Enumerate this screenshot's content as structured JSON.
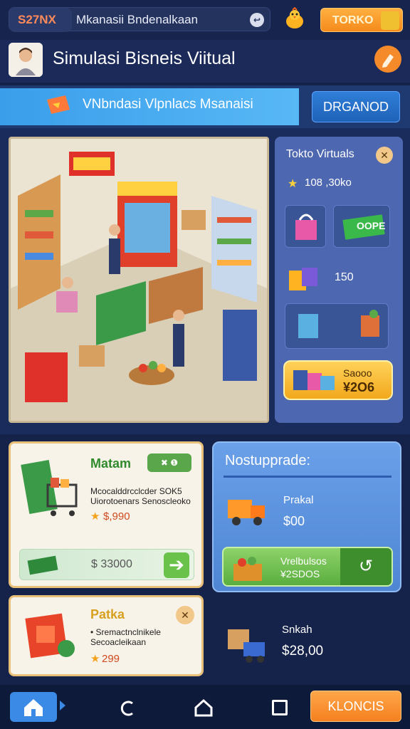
{
  "topbar": {
    "money": "S27NX",
    "search_text": "Mkanasii Bndenalkaan",
    "toko_label": "TORKO"
  },
  "header": {
    "title": "Simulasi Bisneis Viitual"
  },
  "banner": {
    "text": "VNbndasi Vlpnlacs Msanaisi",
    "button": "DRGANOD"
  },
  "side_panel": {
    "title": "Tokto Virtuals",
    "coins": "108 ,30ko",
    "tag": "OOPE",
    "count": "150",
    "buy_line1": "Saooo",
    "buy_line2": "¥2O6"
  },
  "card_a": {
    "title": "Matam",
    "badge": "✖ ❶",
    "desc": "Mcocalddrcclcder SOK5 Uiorotoenars Senoscleoko",
    "price": "$,990",
    "amount": "$ 33000"
  },
  "card_b": {
    "title": "Nostupprade:",
    "label": "Prakal",
    "price": "$00",
    "offer_line1": "Vrelbulsos",
    "offer_line2": "¥2SDOS"
  },
  "card_c": {
    "title": "Patka",
    "desc": "• Sremactnclnikele Secoacleikaan",
    "price": "299"
  },
  "shipping": {
    "label": "Snkah",
    "price": "$28,00"
  },
  "navbar": {
    "cta": "KLONCIS"
  },
  "colors": {
    "background": "#15224a",
    "accent_orange": "#f58a1c",
    "accent_blue": "#3a8ae6",
    "panel_blue": "#4d68b0",
    "card_cream": "#f8f3e8"
  }
}
